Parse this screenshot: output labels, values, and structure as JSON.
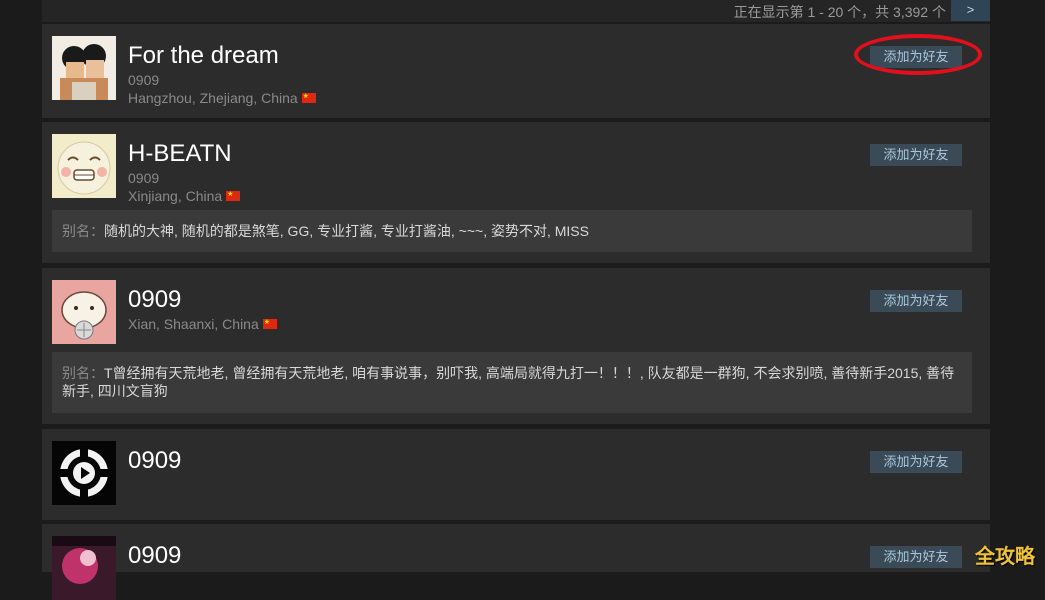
{
  "pager": {
    "text": "正在显示第 1 - 20 个，共 3,392 个",
    "next_label": ">"
  },
  "add_friend_label": "添加为好友",
  "alias_label": "别名：",
  "results": [
    {
      "name": "For the dream",
      "sub": "0909",
      "location": "Hangzhou, Zhejiang, China"
    },
    {
      "name": "H-BEATN",
      "sub": "0909",
      "location": "Xinjiang, China",
      "alias": "随机的大神, 随机的都是煞笔, GG, 专业打酱, 专业打酱油, ~~~, 姿势不对, MISS"
    },
    {
      "name": "0909",
      "location": "Xian, Shaanxi, China",
      "alias": "T曾经拥有天荒地老, 曾经拥有天荒地老, 咱有事说事，别吓我, 高端局就得九打一！！！, 队友都是一群狗, 不会求别喷, 善待新手2015, 善待新手, 四川文盲狗"
    },
    {
      "name": "0909"
    },
    {
      "name": "0909"
    }
  ],
  "watermark": "全攻略"
}
